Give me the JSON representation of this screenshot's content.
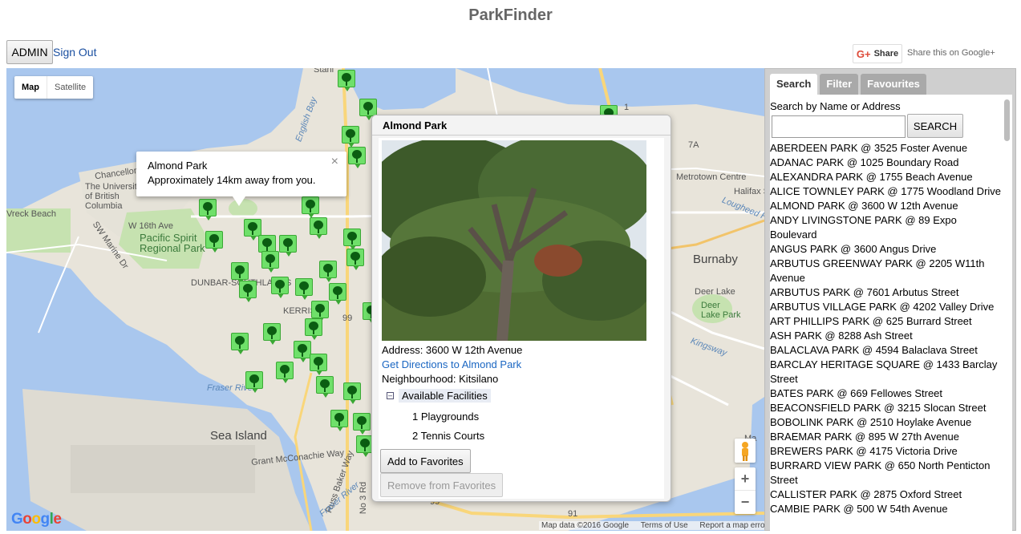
{
  "app": {
    "title": "ParkFinder"
  },
  "header": {
    "admin_label": "ADMIN",
    "signout_label": "Sign Out",
    "share_label": "Share",
    "share_text": "Share this on Google+"
  },
  "map": {
    "type_buttons": [
      "Map",
      "Satellite"
    ],
    "active_type": "Map",
    "labels": {
      "stanley": "Stanl",
      "english_bay": "English Bay",
      "chancellor": "Chancellor Blvd",
      "ubc": "The University of British Columbia",
      "wreck_beach": "Vreck Beach",
      "w16": "W 16th Ave",
      "sw_marine": "SW Marine Dr",
      "pacific_spirit": "Pacific Spirit Regional Park",
      "dunbar": "DUNBAR-SOUTHLANDS",
      "kerrisdale": "KERRISD",
      "fraser_nw": "Fraser River",
      "sea_island": "Sea Island",
      "mcconachie": "Grant McConachie Way",
      "russ_baker": "Russ Baker Way",
      "fraser_n": "Fraser River",
      "no3": "No 3 Rd",
      "metrotown": "Metrotown Centre",
      "halifax": "Halifax St",
      "lougheed": "Lougheed Hwy",
      "burnaby": "Burnaby",
      "deer_lake": "Deer Lake",
      "deer_lake_park": "Deer Lake Park",
      "kingsway": "Kingsway",
      "ma": "Ma",
      "hwy99": "99",
      "hwy99b": "99",
      "hwy91": "91",
      "hwy7a": "7A",
      "hwy1": "1"
    },
    "tooltip": {
      "title": "Almond Park",
      "text": "Approximately 14km away from you.",
      "close": "×"
    },
    "infowindow": {
      "title": "Almond Park",
      "address": "Address: 3600 W 12th Avenue",
      "directions_link": "Get Directions to Almond Park",
      "neighbourhood": "Neighbourhood: Kitsilano",
      "facilities_header": "Available Facilities",
      "facilities": [
        "1 Playgrounds",
        "2 Tennis Courts"
      ],
      "add_fav_label": "Add to Favorites",
      "remove_fav_label": "Remove from Favorites"
    },
    "zoom_in": "+",
    "zoom_out": "−",
    "google": "Google",
    "attribution": [
      "Map data ©2016 Google",
      "Terms of Use",
      "Report a map error"
    ]
  },
  "sidebar": {
    "tabs": [
      "Search",
      "Filter",
      "Favourites"
    ],
    "active_tab": "Search",
    "search_label": "Search by Name or Address",
    "search_value": "",
    "search_button": "SEARCH",
    "parks": [
      "ABERDEEN PARK @ 3525 Foster Avenue",
      "ADANAC PARK @ 1025 Boundary Road",
      "ALEXANDRA PARK @ 1755 Beach Avenue",
      "ALICE TOWNLEY PARK @ 1775 Woodland Drive",
      "ALMOND PARK @ 3600 W 12th Avenue",
      "ANDY LIVINGSTONE PARK @ 89 Expo Boulevard",
      "ANGUS PARK @ 3600 Angus Drive",
      "ARBUTUS GREENWAY PARK @ 2205 W11th Avenue",
      "ARBUTUS PARK @ 7601 Arbutus Street",
      "ARBUTUS VILLAGE PARK @ 4202 Valley Drive",
      "ART PHILLIPS PARK @ 625 Burrard Street",
      "ASH PARK @ 8288 Ash Street",
      "BALACLAVA PARK @ 4594 Balaclava Street",
      "BARCLAY HERITAGE SQUARE @ 1433 Barclay Street",
      "BATES PARK @ 669 Fellowes Street",
      "BEACONSFIELD PARK @ 3215 Slocan Street",
      "BOBOLINK PARK @ 2510 Hoylake Avenue",
      "BRAEMAR PARK @ 895 W 27th Avenue",
      "BREWERS PARK @ 4175 Victoria Drive",
      "BURRARD VIEW PARK @ 650 North Penticton Street",
      "CALLISTER PARK @ 2875 Oxford Street",
      "CAMBIE PARK @ 500 W 54th Avenue"
    ]
  }
}
